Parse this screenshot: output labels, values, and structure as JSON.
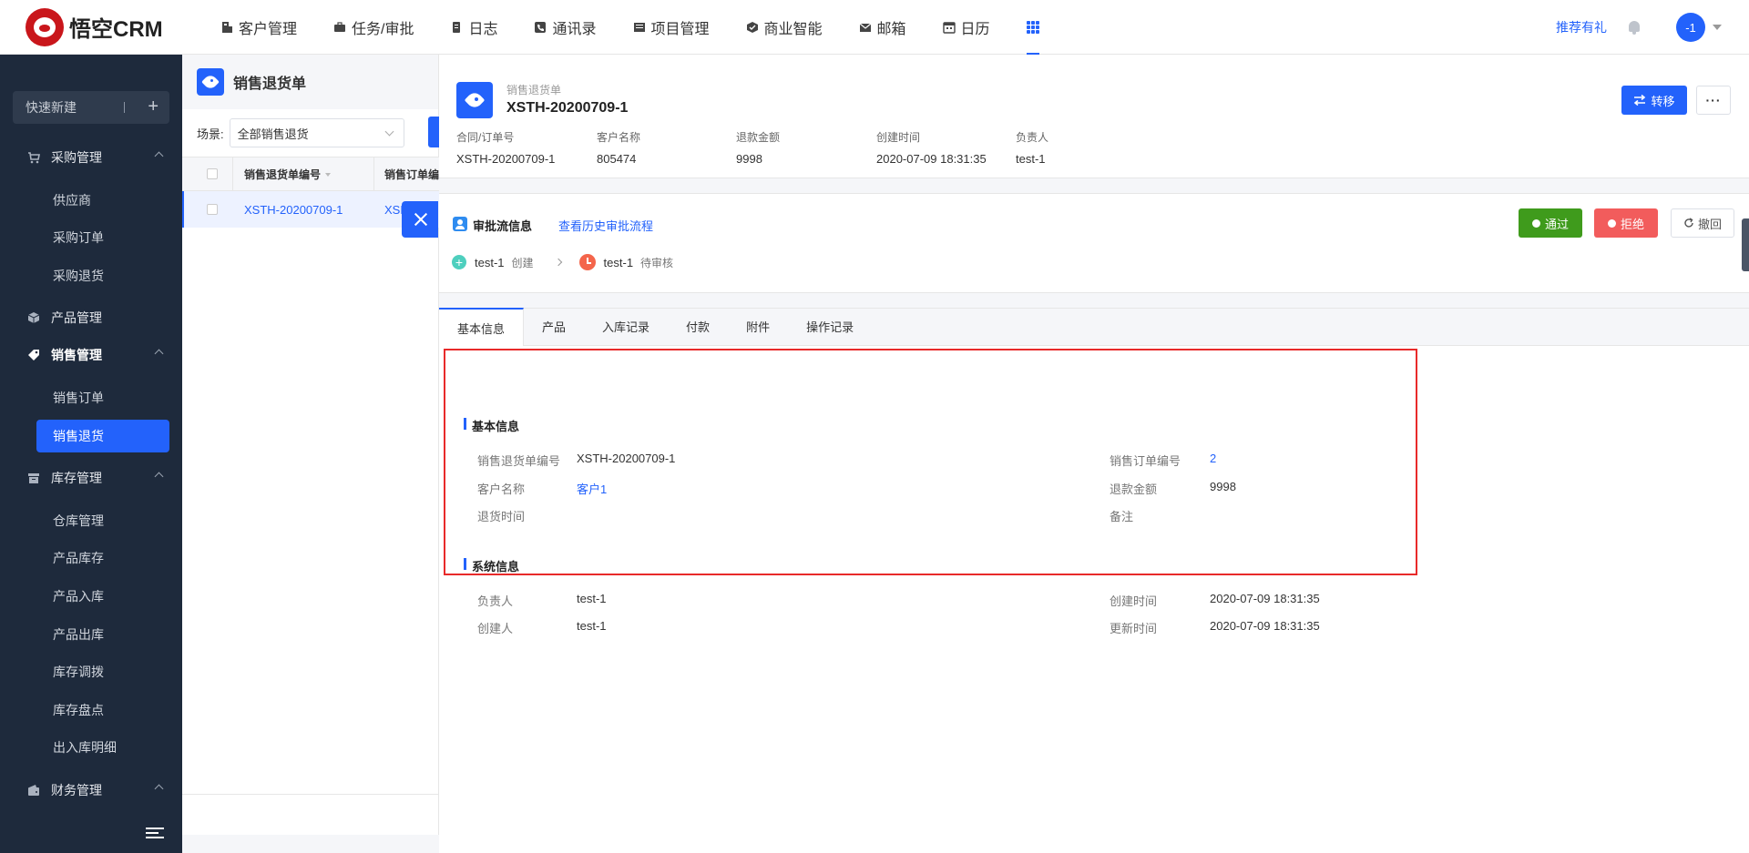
{
  "app": {
    "logo_text": "悟空CRM",
    "nav": [
      {
        "label": "客户管理",
        "icon": "customer-icon"
      },
      {
        "label": "任务/审批",
        "icon": "briefcase-icon"
      },
      {
        "label": "日志",
        "icon": "log-icon"
      },
      {
        "label": "通讯录",
        "icon": "contacts-icon"
      },
      {
        "label": "项目管理",
        "icon": "project-icon"
      },
      {
        "label": "商业智能",
        "icon": "bi-icon"
      },
      {
        "label": "邮箱",
        "icon": "mail-icon"
      },
      {
        "label": "日历",
        "icon": "calendar-icon"
      }
    ],
    "recommend": "推荐有礼",
    "avatar_text": "-1",
    "accent_color": "#2362fb"
  },
  "sidebar": {
    "quick_new": "快速新建",
    "groups": [
      {
        "label": "采购管理",
        "items": [
          "供应商",
          "采购订单",
          "采购退货"
        ]
      },
      {
        "label": "产品管理",
        "items": []
      },
      {
        "label": "销售管理",
        "items": [
          "销售订单",
          "销售退货"
        ],
        "active_item": "销售退货"
      },
      {
        "label": "库存管理",
        "items": [
          "仓库管理",
          "产品库存",
          "产品入库",
          "产品出库",
          "库存调拨",
          "库存盘点",
          "出入库明细"
        ]
      },
      {
        "label": "财务管理",
        "items": []
      }
    ]
  },
  "list": {
    "title": "销售退货单",
    "scene_label": "场景:",
    "scene_value": "全部销售退货",
    "columns": [
      "销售退货单编号",
      "销售订单编"
    ],
    "rows": [
      {
        "col1": "XSTH-20200709-1",
        "col2": "XSD"
      }
    ]
  },
  "detail": {
    "subtitle": "销售退货单",
    "title": "XSTH-20200709-1",
    "transfer_label": "转移",
    "more_label": "···",
    "meta": [
      {
        "label": "合同/订单号",
        "value": "XSTH-20200709-1"
      },
      {
        "label": "客户名称",
        "value": "805474"
      },
      {
        "label": "退款金额",
        "value": "9998"
      },
      {
        "label": "创建时间",
        "value": "2020-07-09 18:31:35"
      },
      {
        "label": "负责人",
        "value": "test-1"
      }
    ],
    "approval": {
      "title": "审批流信息",
      "history_link": "查看历史审批流程",
      "pass_label": "通过",
      "reject_label": "拒绝",
      "withdraw_label": "撤回",
      "steps": [
        {
          "name": "test-1",
          "status": "创建"
        },
        {
          "name": "test-1",
          "status": "待审核"
        }
      ]
    },
    "tabs": [
      "基本信息",
      "产品",
      "入库记录",
      "付款",
      "附件",
      "操作记录"
    ],
    "basic": {
      "title": "基本信息",
      "fields": [
        {
          "label": "销售退货单编号",
          "value": "XSTH-20200709-1"
        },
        {
          "label": "销售订单编号",
          "value": "2"
        },
        {
          "label": "客户名称",
          "value": "客户1"
        },
        {
          "label": "退款金额",
          "value": "9998"
        },
        {
          "label": "退货时间",
          "value": ""
        },
        {
          "label": "备注",
          "value": ""
        }
      ]
    },
    "system": {
      "title": "系统信息",
      "fields": [
        {
          "label": "负责人",
          "value": "test-1"
        },
        {
          "label": "创建时间",
          "value": "2020-07-09 18:31:35"
        },
        {
          "label": "创建人",
          "value": "test-1"
        },
        {
          "label": "更新时间",
          "value": "2020-07-09 18:31:35"
        }
      ]
    }
  }
}
